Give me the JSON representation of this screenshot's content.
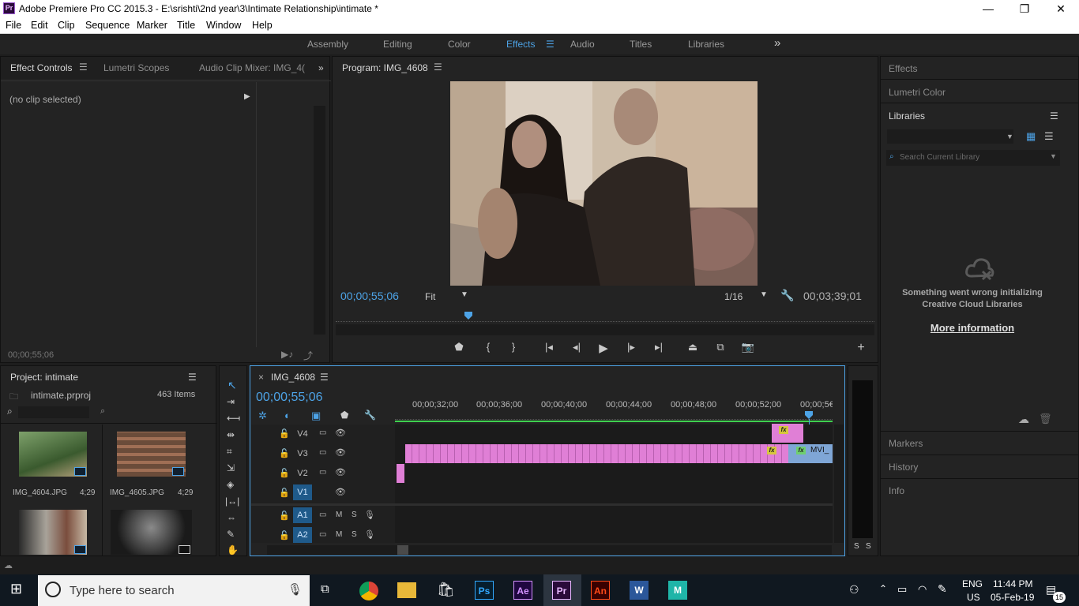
{
  "window": {
    "title": "Adobe Premiere Pro CC 2015.3 - E:\\srishti\\2nd year\\3\\Intimate Relationship\\intimate *",
    "logo": "Pr",
    "minimize": "—",
    "restore": "❐",
    "close": "✕"
  },
  "menu": [
    "File",
    "Edit",
    "Clip",
    "Sequence",
    "Marker",
    "Title",
    "Window",
    "Help"
  ],
  "workspaces": {
    "items": [
      "Assembly",
      "Editing",
      "Color",
      "Effects",
      "Audio",
      "Titles",
      "Libraries"
    ],
    "active": "Effects",
    "more": "»"
  },
  "effect_controls": {
    "tabs": [
      "Effect Controls",
      "Lumetri Scopes",
      "Audio Clip Mixer: IMG_4("
    ],
    "no_clip": "(no clip selected)",
    "timecode": "00;00;55;06"
  },
  "program": {
    "title": "Program: IMG_4608",
    "timecode_current": "00;00;55;06",
    "zoom": "Fit",
    "resolution": "1/16",
    "timecode_duration": "00;03;39;01",
    "playhead_fraction": 0.25
  },
  "right_panels": {
    "effects": "Effects",
    "lumetri_color": "Lumetri Color",
    "libraries": "Libraries",
    "search_placeholder": "Search Current Library",
    "error_line1": "Something went wrong initializing",
    "error_line2": "Creative Cloud Libraries",
    "more_info": "More information",
    "markers": "Markers",
    "history": "History",
    "info": "Info"
  },
  "project": {
    "title": "Project: intimate",
    "file": "intimate.prproj",
    "item_count": "463 Items",
    "items": [
      {
        "name": "IMG_4604.JPG",
        "duration": "4;29"
      },
      {
        "name": "IMG_4605.JPG",
        "duration": "4;29"
      },
      {
        "name": "",
        "duration": ""
      },
      {
        "name": "",
        "duration": ""
      }
    ]
  },
  "timeline": {
    "sequence": "IMG_4608",
    "close": "×",
    "timecode": "00;00;55;06",
    "ruler": [
      "00;00;32;00",
      "00;00;36;00",
      "00;00;40;00",
      "00;00;44;00",
      "00;00;48;00",
      "00;00;52;00",
      "00;00;5€"
    ],
    "tracks": [
      {
        "name": "V4",
        "active": false
      },
      {
        "name": "V3",
        "active": false
      },
      {
        "name": "V2",
        "active": false
      },
      {
        "name": "V1",
        "active": true
      },
      {
        "name": "A1",
        "active": true
      },
      {
        "name": "A2",
        "active": true
      }
    ],
    "clip_label": "MVI_",
    "fx": "fx",
    "m": "M",
    "s": "S"
  },
  "audio_meter": {
    "left": "S",
    "right": "S"
  },
  "taskbar": {
    "search_placeholder": "Type here to search",
    "apps": [
      "Ps",
      "Ae",
      "Pr",
      "An",
      "W",
      "M"
    ],
    "lang1": "ENG",
    "lang2": "US",
    "time": "11:44 PM",
    "date": "05-Feb-19",
    "notifications": "15"
  },
  "colors": {
    "accent": "#4da3e6",
    "clip_pink": "#e07fd6",
    "clip_blue": "#7fa6d6",
    "fx_yellow": "#d6c73e",
    "track_active": "#1f5a8a"
  }
}
